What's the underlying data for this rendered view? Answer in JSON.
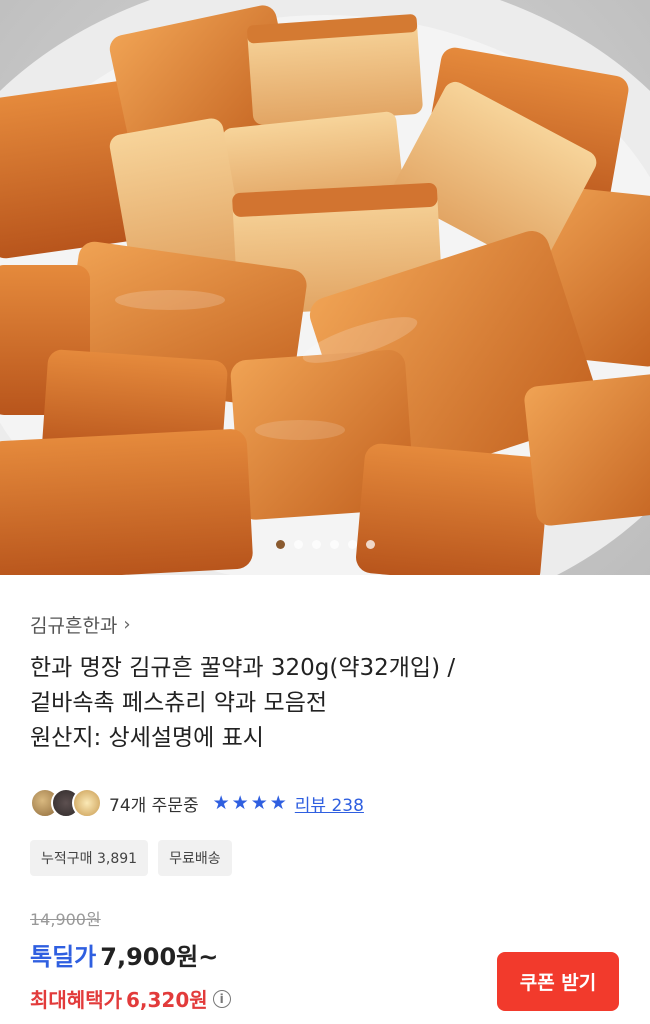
{
  "product": {
    "image": {
      "alt": "",
      "slide_count": 6,
      "active_slide": 1
    },
    "brand": {
      "name": "김규흔한과",
      "chevron_icon": "chevron-right-icon"
    },
    "title_lines": [
      "한과 명장 김규흔 꿀약과 320g(약32개입) /",
      "겉바속촉 페스츄리 약과 모음전",
      "원산지: 상세설명에 표시"
    ],
    "social": {
      "orders_text": "74개 주문중",
      "rating_stars": 4,
      "star_color": "#2f5fe0",
      "review_text": "리뷰 238"
    },
    "tags": [
      "누적구매 3,891",
      "무료배송"
    ],
    "price": {
      "original": "14,900원",
      "sale_label": "톡딜가",
      "sale_price": "7,900원~",
      "max_label": "최대혜택가",
      "max_price": "6,320원",
      "info_icon": "info-circle-icon"
    },
    "coupon_button": "쿠폰 받기",
    "colors": {
      "accent_blue": "#2f5fe0",
      "accent_red": "#e23b3b",
      "coupon_bg": "#f23a2c"
    }
  }
}
